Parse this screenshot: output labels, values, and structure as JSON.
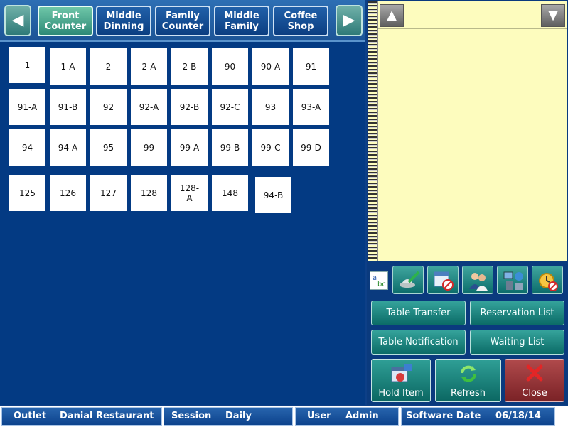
{
  "tabs": [
    {
      "label": "Front\nCounter",
      "active": true
    },
    {
      "label": "Middle\nDinning",
      "active": false
    },
    {
      "label": "Family\nCounter",
      "active": false
    },
    {
      "label": "Middle\nFamily",
      "active": false
    },
    {
      "label": "Coffee\nShop",
      "active": false
    }
  ],
  "nav_icons": {
    "prev": "left-arrow-icon",
    "next": "right-arrow-icon"
  },
  "tables": [
    "1",
    "1-A",
    "2",
    "2-A",
    "2-B",
    "90",
    "90-A",
    "91",
    "91-A",
    "91-B",
    "92",
    "92-A",
    "92-B",
    "92-C",
    "93",
    "93-A",
    "94",
    "94-A",
    "95",
    "99",
    "99-A",
    "99-B",
    "99-C",
    "99-D",
    "125",
    "126",
    "127",
    "128",
    "128-\nA",
    "148",
    "94-B"
  ],
  "notepad": {
    "up_icon": "up-arrow-icon",
    "down_icon": "down-arrow-icon"
  },
  "toolbar_icons": [
    "spell-check-icon",
    "serve-dish-icon",
    "cancel-schedule-icon",
    "customer-icon",
    "network-icon",
    "alarm-clock-icon"
  ],
  "actions": {
    "table_transfer": "Table Transfer",
    "reservation_list": "Reservation List",
    "table_notification": "Table Notification",
    "waiting_list": "Waiting List"
  },
  "buttons": {
    "hold_item": "Hold Item",
    "refresh": "Refresh",
    "close": "Close"
  },
  "status": {
    "outlet_label": "Outlet",
    "outlet_value": "Danial Restaurant",
    "session_label": "Session",
    "session_value": "Daily",
    "user_label": "User",
    "user_value": "Admin",
    "date_label": "Software Date",
    "date_value": "06/18/14"
  },
  "colors": {
    "background": "#033a83",
    "active_tab": "#4caf93",
    "notepad": "#fdfcbe",
    "teal_button": "#1a847f",
    "close_button": "#9a3538"
  }
}
